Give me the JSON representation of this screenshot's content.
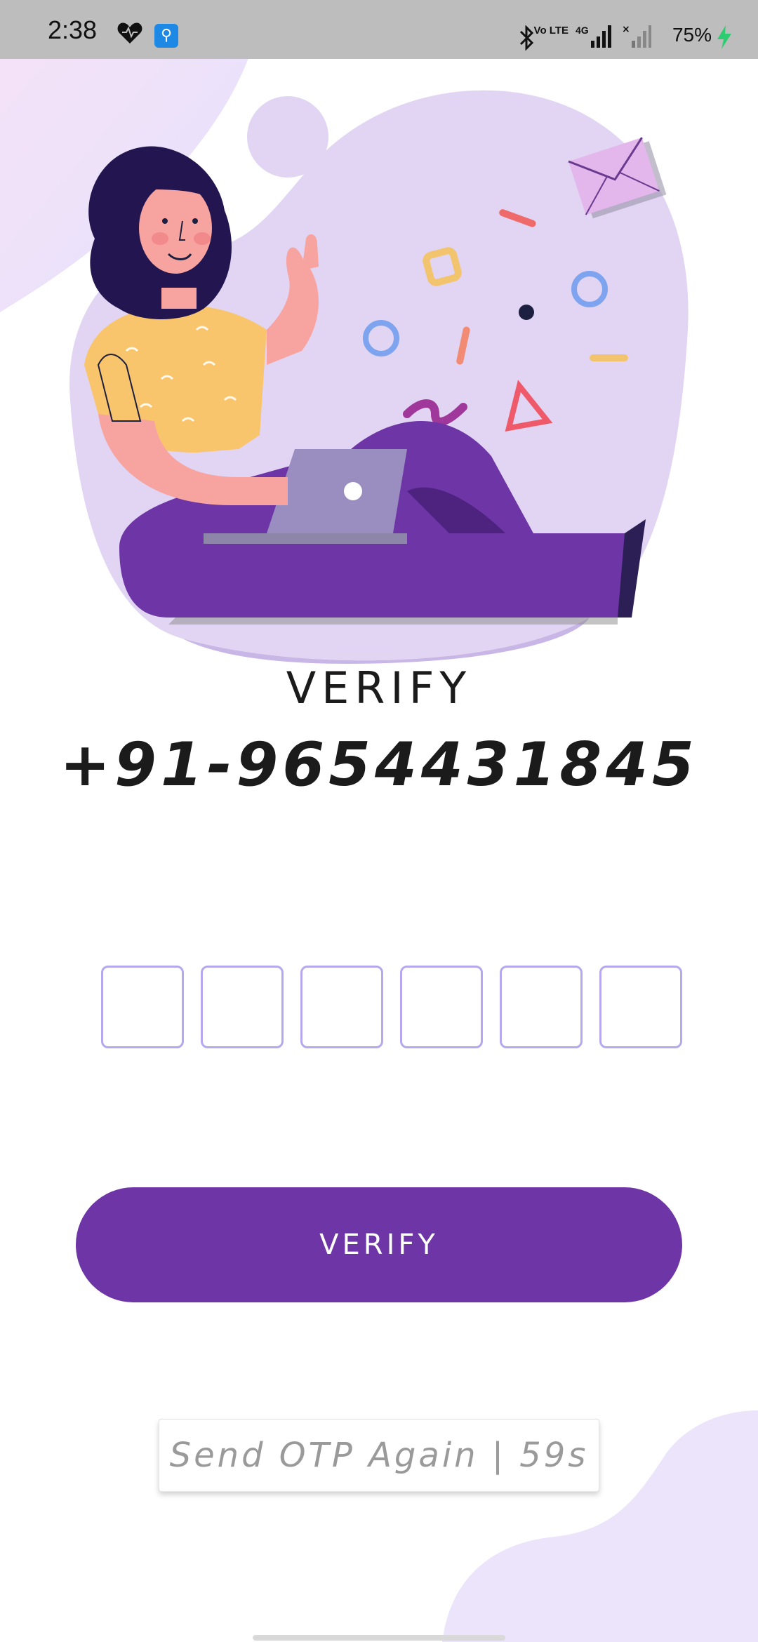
{
  "status_bar": {
    "time": "2:38",
    "network": "4G",
    "volte": "Vo LTE",
    "battery": "75%",
    "icons": [
      "heart-icon",
      "usb-icon",
      "bluetooth-icon",
      "signal-icon",
      "battery-charging-icon"
    ]
  },
  "verify": {
    "title": "VERIFY",
    "phone": "+91-9654431845"
  },
  "otp": {
    "digits": [
      "",
      "",
      "",
      "",
      "",
      ""
    ]
  },
  "actions": {
    "verify_label": "VERIFY",
    "resend_label": "Send OTP Again | 59s"
  },
  "colors": {
    "primary": "#6d35a5",
    "otp_border": "#b6a8ee",
    "blob": "#e1d5f3",
    "text": "#1b1b1b",
    "resend_text": "#9a9a9a"
  }
}
